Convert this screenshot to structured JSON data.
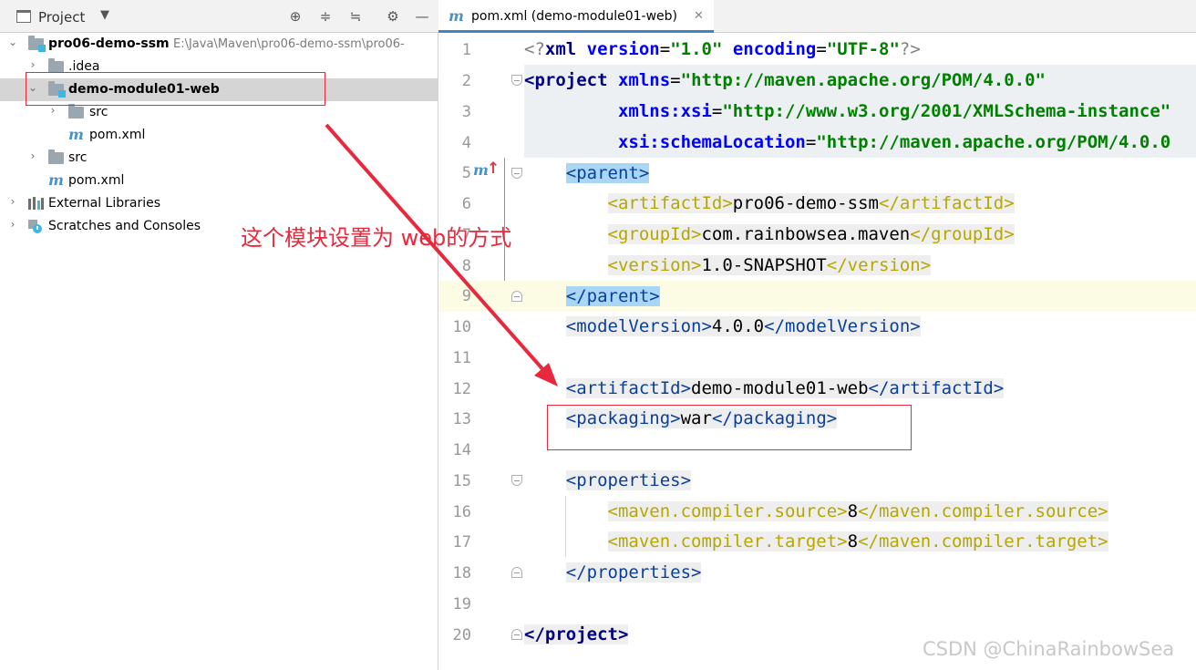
{
  "project_panel": {
    "title": "Project",
    "tree": [
      {
        "label": "pro06-demo-ssm",
        "path": "E:\\Java\\Maven\\pro06-demo-ssm\\pro06-",
        "bold": true
      },
      {
        "label": ".idea"
      },
      {
        "label": "demo-module01-web",
        "bold": true,
        "selected": true
      },
      {
        "label": "src"
      },
      {
        "label": "pom.xml"
      },
      {
        "label": "src"
      },
      {
        "label": "pom.xml"
      },
      {
        "label": "External Libraries"
      },
      {
        "label": "Scratches and Consoles"
      }
    ]
  },
  "editor": {
    "tab_label": "pom.xml (demo-module01-web)",
    "line_numbers": [
      "1",
      "2",
      "3",
      "4",
      "5",
      "6",
      "7",
      "8",
      "9",
      "10",
      "11",
      "12",
      "13",
      "14",
      "15",
      "16",
      "17",
      "18",
      "19",
      "20"
    ],
    "code": {
      "l1_pi_open": "<?",
      "l1_xml": "xml",
      "l1_version_attr": "version",
      "l1_version_val": "\"1.0\"",
      "l1_encoding_attr": "encoding",
      "l1_encoding_val": "\"UTF-8\"",
      "l1_pi_close": "?>",
      "l2_tag": "<project",
      "l2_attr": "xmlns",
      "l2_val": "\"http://maven.apache.org/POM/4.0.0\"",
      "l3_attr": "xmlns:xsi",
      "l3_val": "\"http://www.w3.org/2001/XMLSchema-instance\"",
      "l4_attr": "xsi:schemaLocation",
      "l4_val": "\"http://maven.apache.org/POM/4.0.0",
      "l5_tag": "<parent>",
      "l6_open": "<artifactId>",
      "l6_text": "pro06-demo-ssm",
      "l6_close": "</artifactId>",
      "l7_open": "<groupId>",
      "l7_text": "com.rainbowsea.maven",
      "l7_close": "</groupId>",
      "l8_open": "<version>",
      "l8_text": "1.0-SNAPSHOT",
      "l8_close": "</version>",
      "l9_tag": "</parent>",
      "l10_open": "<modelVersion>",
      "l10_text": "4.0.0",
      "l10_close": "</modelVersion>",
      "l12_open": "<artifactId>",
      "l12_text": "demo-module01-web",
      "l12_close": "</artifactId>",
      "l13_open": "<packaging>",
      "l13_text": "war",
      "l13_close": "</packaging>",
      "l15_tag": "<properties>",
      "l16_open": "<maven.compiler.source>",
      "l16_text": "8",
      "l16_close": "</maven.compiler.source>",
      "l17_open": "<maven.compiler.target>",
      "l17_text": "8",
      "l17_close": "</maven.compiler.target>",
      "l18_tag": "</properties>",
      "l20_tag": "</project>"
    }
  },
  "annotation": {
    "text": "这个模块设置为 web的方式",
    "color": "#e8283c"
  },
  "watermark": "CSDN @ChinaRainbowSea",
  "icons": [
    "project-icon",
    "dropdown-icon",
    "locate-icon",
    "expand-all-icon",
    "collapse-all-icon",
    "gear-icon",
    "minimize-icon",
    "folder-icon",
    "maven-m-icon",
    "library-icon",
    "scratches-icon",
    "close-icon",
    "fold-icon",
    "overrides-up-icon"
  ]
}
